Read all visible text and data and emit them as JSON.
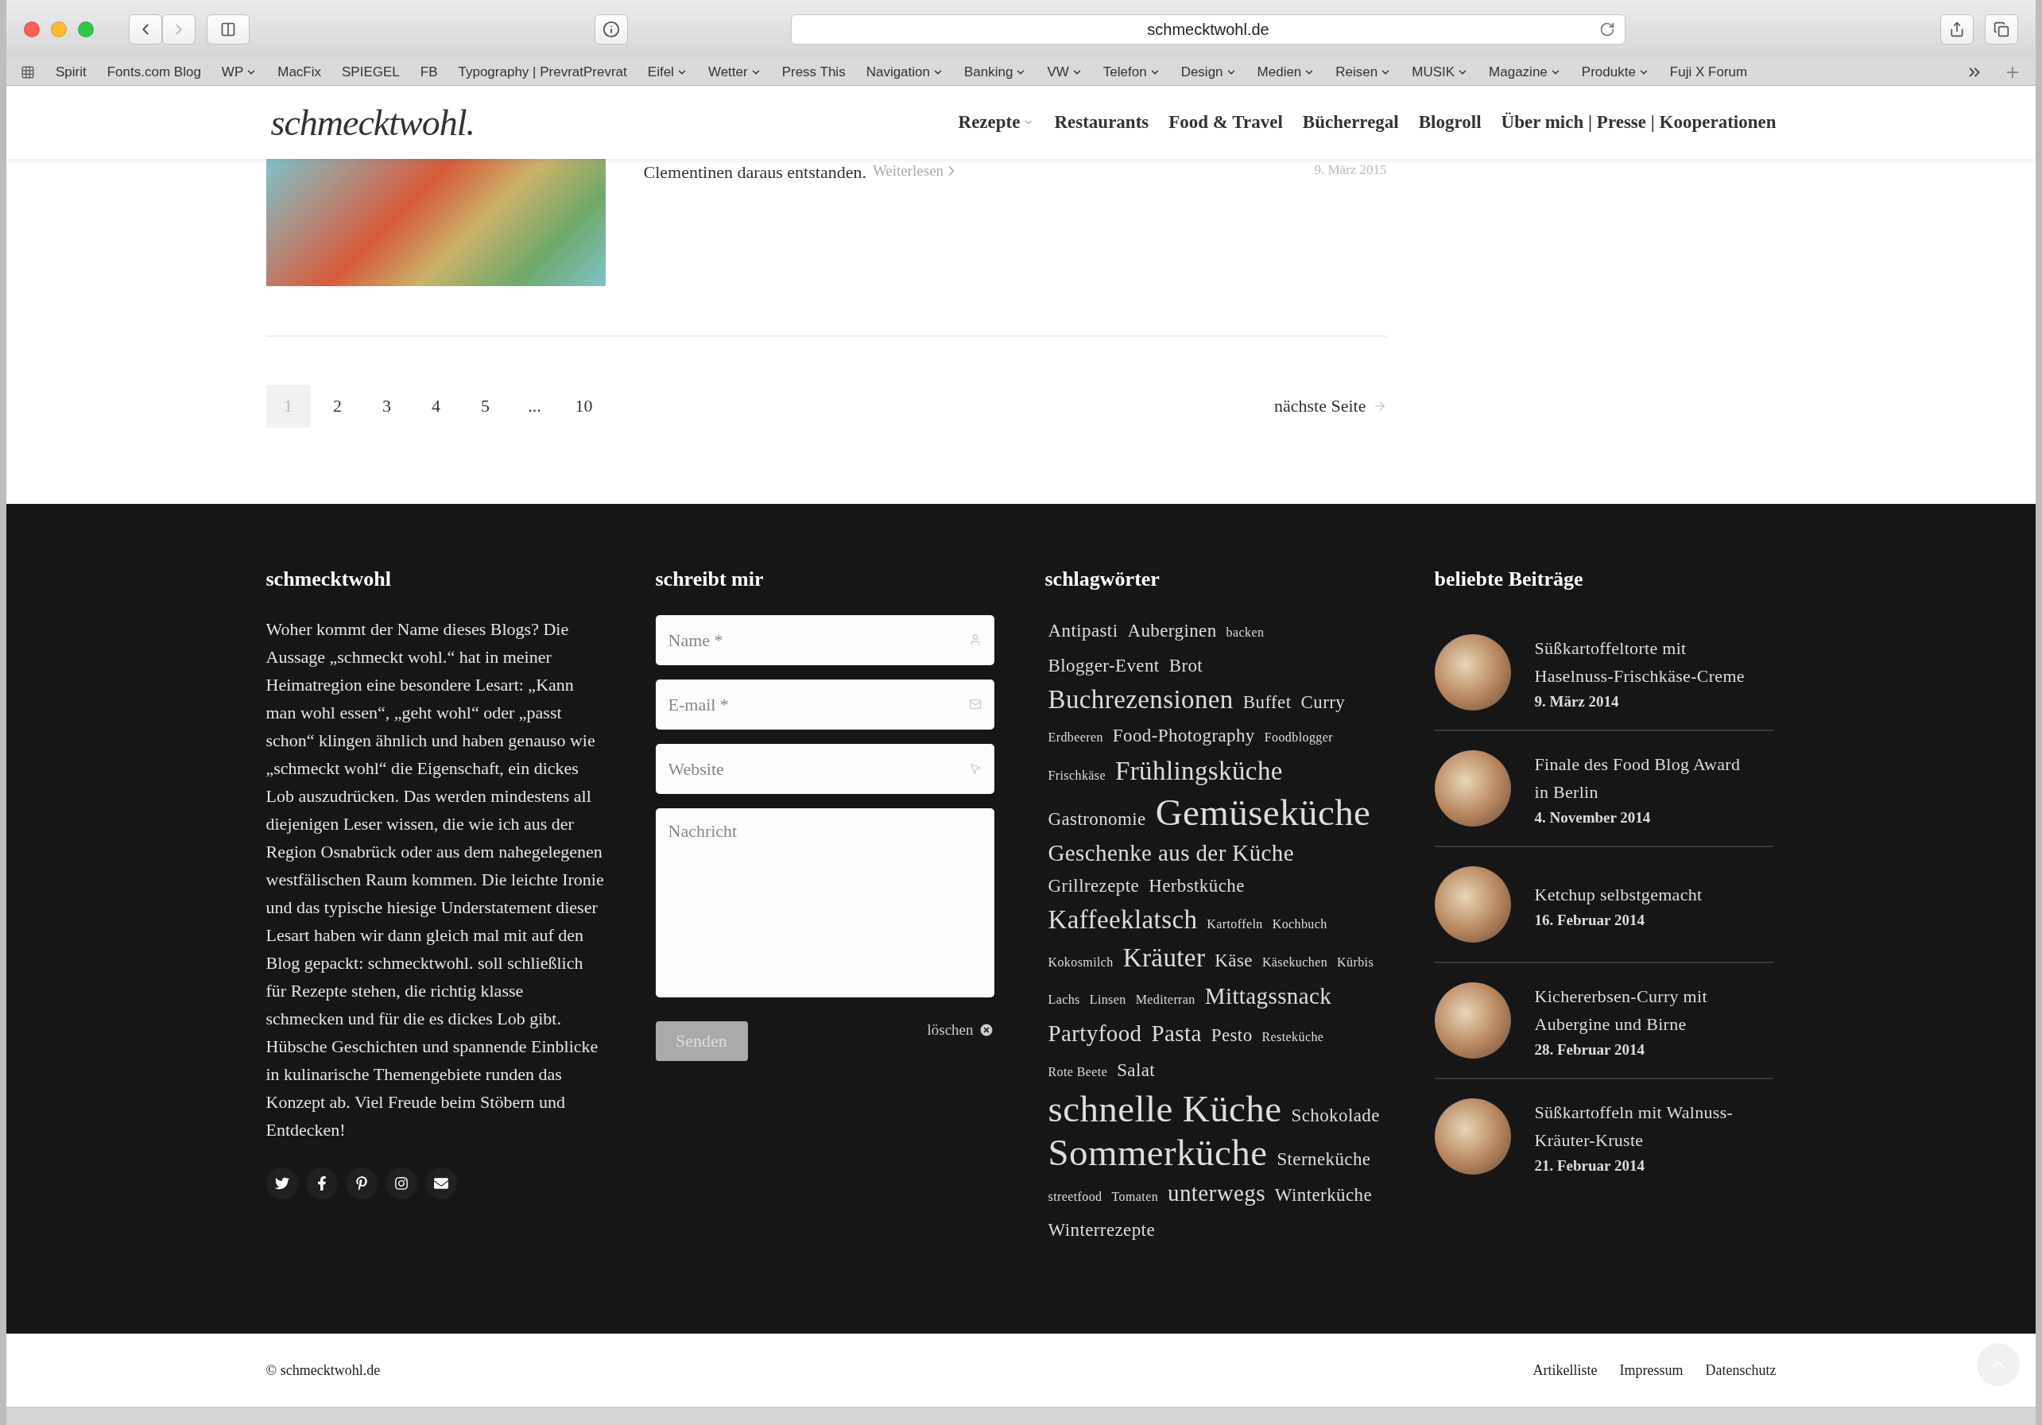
{
  "browser": {
    "address": "schmecktwohl.de",
    "bookmarks": [
      {
        "label": "Spirit",
        "dropdown": false
      },
      {
        "label": "Fonts.com Blog",
        "dropdown": false
      },
      {
        "label": "WP",
        "dropdown": true
      },
      {
        "label": "MacFix",
        "dropdown": false
      },
      {
        "label": "SPIEGEL",
        "dropdown": false
      },
      {
        "label": "FB",
        "dropdown": false
      },
      {
        "label": "Typography | PrevratPrevrat",
        "dropdown": false
      },
      {
        "label": "Eifel",
        "dropdown": true
      },
      {
        "label": "Wetter",
        "dropdown": true
      },
      {
        "label": "Press This",
        "dropdown": false
      },
      {
        "label": "Navigation",
        "dropdown": true
      },
      {
        "label": "Banking",
        "dropdown": true
      },
      {
        "label": "VW",
        "dropdown": true
      },
      {
        "label": "Telefon",
        "dropdown": true
      },
      {
        "label": "Design",
        "dropdown": true
      },
      {
        "label": "Medien",
        "dropdown": true
      },
      {
        "label": "Reisen",
        "dropdown": true
      },
      {
        "label": "MUSIK",
        "dropdown": true
      },
      {
        "label": "Magazine",
        "dropdown": true
      },
      {
        "label": "Produkte",
        "dropdown": true
      },
      {
        "label": "Fuji X Forum",
        "dropdown": false
      }
    ]
  },
  "header": {
    "logo": "schmecktwohl.",
    "nav": [
      {
        "label": "Rezepte",
        "dropdown": true
      },
      {
        "label": "Restaurants",
        "dropdown": false
      },
      {
        "label": "Food & Travel",
        "dropdown": false
      },
      {
        "label": "Bücherregal",
        "dropdown": false
      },
      {
        "label": "Blogroll",
        "dropdown": false
      },
      {
        "label": "Über mich | Presse | Kooperationen",
        "dropdown": false
      }
    ]
  },
  "article": {
    "excerpt": "Clementinen daraus entstanden.",
    "read_more": "Weiterlesen",
    "date": "9. März 2015"
  },
  "pagination": {
    "pages": [
      {
        "label": "1",
        "selected": true
      },
      {
        "label": "2",
        "selected": false
      },
      {
        "label": "3",
        "selected": false
      },
      {
        "label": "4",
        "selected": false
      },
      {
        "label": "5",
        "selected": false
      },
      {
        "label": "...",
        "selected": false
      },
      {
        "label": "10",
        "selected": false
      }
    ],
    "next": "nächste Seite"
  },
  "footer": {
    "about": {
      "title": "schmecktwohl",
      "text": "Woher kommt der Name dieses Blogs? Die Aussage „schmeckt wohl.“ hat in meiner Heimatregion eine besondere Lesart: „Kann man wohl essen“, „geht wohl“ oder „passt schon“ klingen ähnlich und haben genauso wie „schmeckt wohl“ die Eigenschaft, ein dickes Lob auszudrücken. Das werden mindestens all diejenigen Leser wissen, die wie ich aus der Region Osnabrück oder aus dem nahegelegenen westfälischen Raum kommen. Die leichte Ironie und das typische hiesige Understatement dieser Lesart haben wir dann gleich mal mit auf den Blog gepackt: schmecktwohl. soll schließlich für Rezepte stehen, die richtig klasse schmecken und für die es dickes Lob gibt. Hübsche Geschichten und spannende Einblicke in kulinarische Themengebiete runden das Konzept ab. Viel Freude beim Stöbern und Entdecken!",
      "socials": [
        {
          "kind": "twitter"
        },
        {
          "kind": "facebook"
        },
        {
          "kind": "pinterest"
        },
        {
          "kind": "instagram"
        },
        {
          "kind": "mail"
        }
      ]
    },
    "contact": {
      "title": "schreibt mir",
      "fields": [
        {
          "placeholder": "Name *",
          "kind": "person"
        },
        {
          "placeholder": "E-mail *",
          "kind": "mail"
        },
        {
          "placeholder": "Website",
          "kind": "pointer"
        }
      ],
      "message_placeholder": "Nachricht",
      "submit": "Senden",
      "clear": "löschen"
    },
    "tags": {
      "title": "schlagwörter",
      "items": [
        {
          "label": "Antipasti",
          "kind": "small"
        },
        {
          "label": "Auberginen",
          "kind": "small"
        },
        {
          "label": "backen",
          "kind": "tiny"
        },
        {
          "label": "Blogger-Event",
          "kind": "small"
        },
        {
          "label": "Brot",
          "kind": "small"
        },
        {
          "label": "Buchrezensionen",
          "kind": "large"
        },
        {
          "label": "Buffet",
          "kind": "small"
        },
        {
          "label": "Curry",
          "kind": "small"
        },
        {
          "label": "Erdbeeren",
          "kind": "tiny"
        },
        {
          "label": "Food-Photography",
          "kind": "small"
        },
        {
          "label": "Foodblogger",
          "kind": "tiny"
        },
        {
          "label": "Frischkäse",
          "kind": "tiny"
        },
        {
          "label": "Frühlingsküche",
          "kind": "large"
        },
        {
          "label": "Gastronomie",
          "kind": "small"
        },
        {
          "label": "Gemüseküche",
          "kind": "huge"
        },
        {
          "label": "Geschenke aus der Küche",
          "kind": "medium"
        },
        {
          "label": "Grillrezepte",
          "kind": "small"
        },
        {
          "label": "Herbstküche",
          "kind": "small"
        },
        {
          "label": "Kaffeeklatsch",
          "kind": "large"
        },
        {
          "label": "Kartoffeln",
          "kind": "tiny"
        },
        {
          "label": "Kochbuch",
          "kind": "tiny"
        },
        {
          "label": "Kokosmilch",
          "kind": "tiny"
        },
        {
          "label": "Kräuter",
          "kind": "large"
        },
        {
          "label": "Käse",
          "kind": "small"
        },
        {
          "label": "Käsekuchen",
          "kind": "tiny"
        },
        {
          "label": "Kürbis",
          "kind": "tiny"
        },
        {
          "label": "Lachs",
          "kind": "tiny"
        },
        {
          "label": "Linsen",
          "kind": "tiny"
        },
        {
          "label": "Mediterran",
          "kind": "tiny"
        },
        {
          "label": "Mittagssnack",
          "kind": "medium"
        },
        {
          "label": "Partyfood",
          "kind": "medium"
        },
        {
          "label": "Pasta",
          "kind": "medium"
        },
        {
          "label": "Pesto",
          "kind": "small"
        },
        {
          "label": "Resteküche",
          "kind": "tiny"
        },
        {
          "label": "Rote Beete",
          "kind": "tiny"
        },
        {
          "label": "Salat",
          "kind": "small"
        },
        {
          "label": "schnelle Küche",
          "kind": "huge"
        },
        {
          "label": "Schokolade",
          "kind": "small"
        },
        {
          "label": "Sommerküche",
          "kind": "huge"
        },
        {
          "label": "Sterneküche",
          "kind": "small"
        },
        {
          "label": "streetfood",
          "kind": "tiny"
        },
        {
          "label": "Tomaten",
          "kind": "tiny"
        },
        {
          "label": "unterwegs",
          "kind": "medium"
        },
        {
          "label": "Winterküche",
          "kind": "small"
        },
        {
          "label": "Winterrezepte",
          "kind": "small"
        }
      ]
    },
    "popular": {
      "title": "beliebte Beiträge",
      "posts": [
        {
          "title": "Süßkartoffeltorte mit Haselnuss-Frischkäse-Creme",
          "date": "9. März 2014"
        },
        {
          "title": "Finale des Food Blog Award in Berlin",
          "date": "4. November 2014"
        },
        {
          "title": "Ketchup selbstgemacht",
          "date": "16. Februar 2014"
        },
        {
          "title": "Kichererbsen-Curry mit Aubergine und Birne",
          "date": "28. Februar 2014"
        },
        {
          "title": "Süßkartoffeln mit Walnuss-Kräuter-Kruste",
          "date": "21. Februar 2014"
        }
      ]
    }
  },
  "bottom_bar": {
    "copyright": "© schmecktwohl.de",
    "links": [
      "Artikelliste",
      "Impressum",
      "Datenschutz"
    ]
  }
}
